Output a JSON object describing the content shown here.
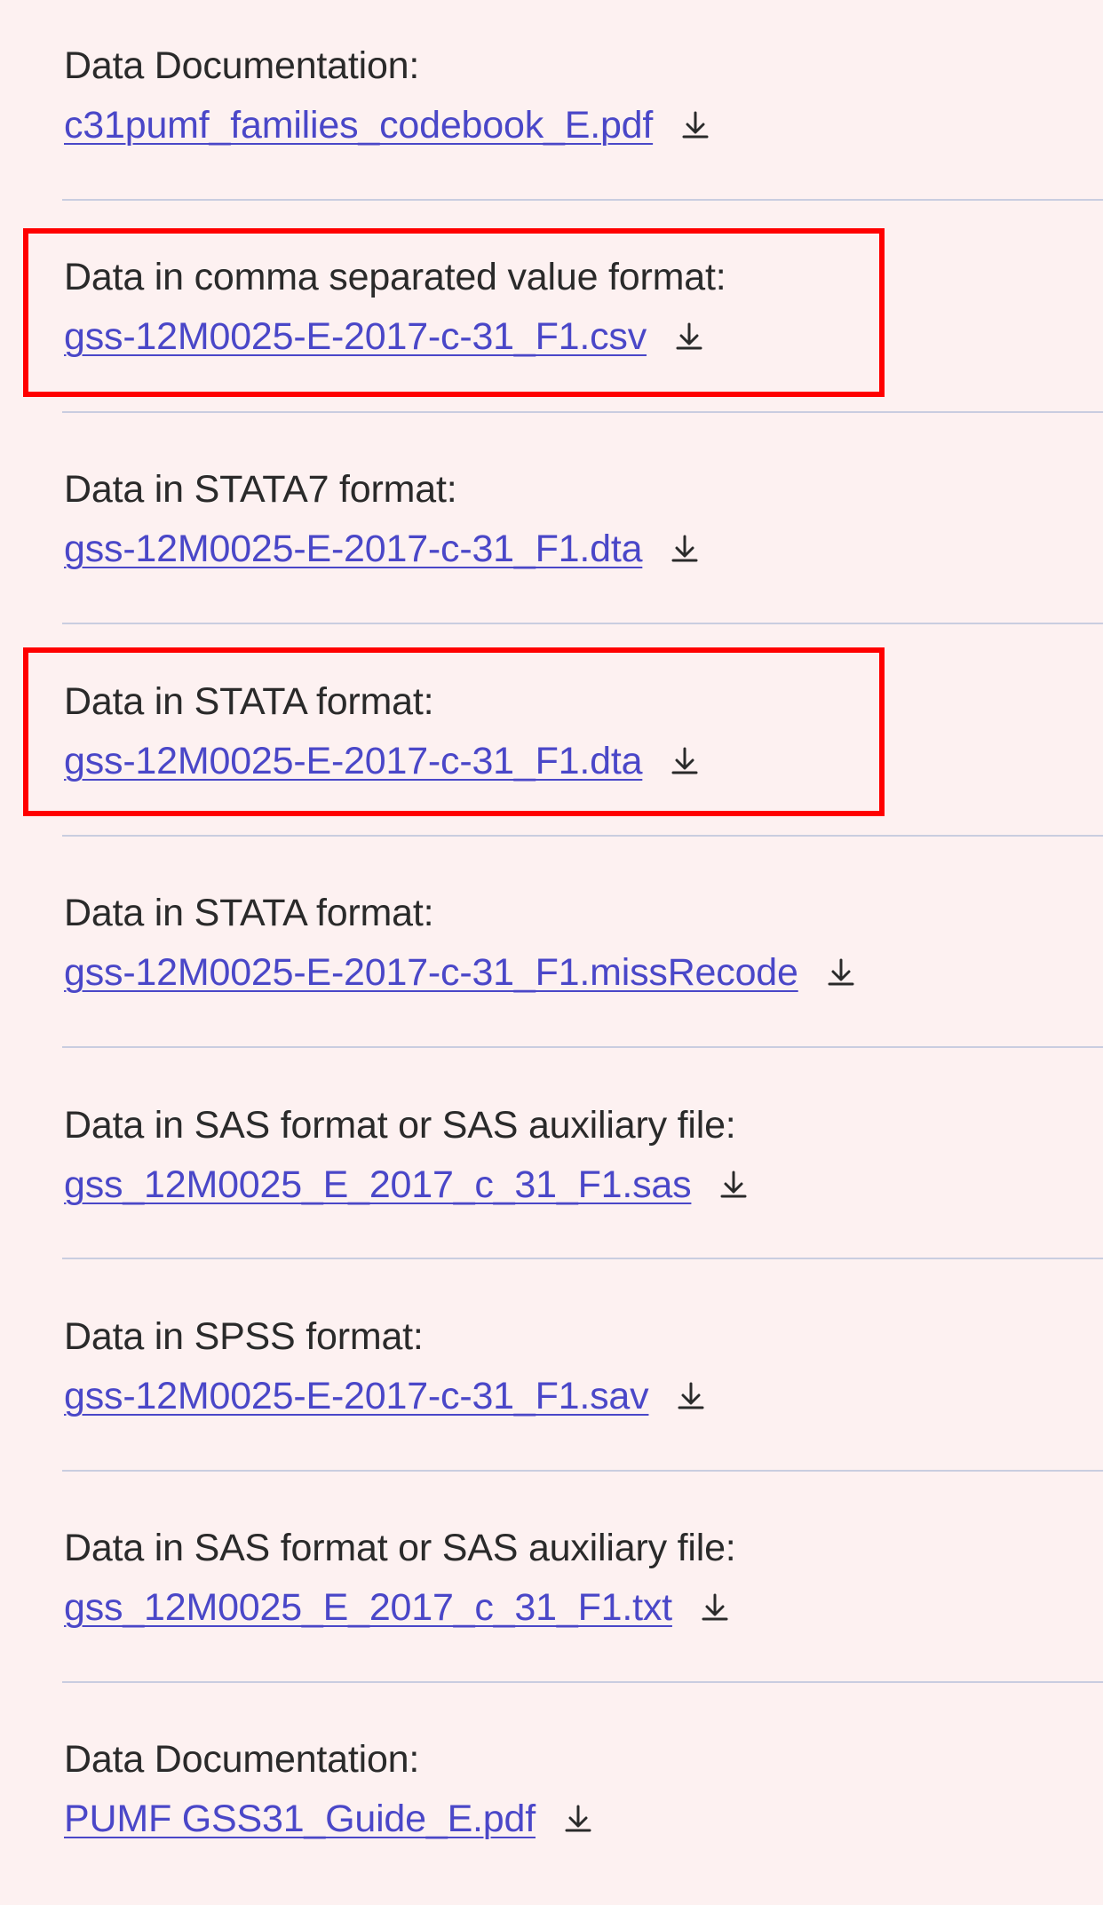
{
  "entries": [
    {
      "label": "Data Documentation:",
      "link": "c31pumf_families_codebook_E.pdf",
      "icon": "download-icon"
    },
    {
      "label": "Data in comma separated value format:",
      "link": "gss-12M0025-E-2017-c-31_F1.csv",
      "icon": "download-icon"
    },
    {
      "label": "Data in STATA7 format:",
      "link": "gss-12M0025-E-2017-c-31_F1.dta",
      "icon": "download-icon"
    },
    {
      "label": "Data in STATA format:",
      "link": "gss-12M0025-E-2017-c-31_F1.dta",
      "icon": "download-icon"
    },
    {
      "label": "Data in STATA format:",
      "link": "gss-12M0025-E-2017-c-31_F1.missRecode",
      "icon": "download-icon"
    },
    {
      "label": "Data in SAS format or SAS auxiliary file:",
      "link": "gss_12M0025_E_2017_c_31_F1.sas",
      "icon": "download-icon"
    },
    {
      "label": "Data in SPSS format:",
      "link": "gss-12M0025-E-2017-c-31_F1.sav",
      "icon": "download-icon"
    },
    {
      "label": "Data in SAS format or SAS auxiliary file:",
      "link": "gss_12M0025_E_2017_c_31_F1.txt",
      "icon": "download-icon"
    },
    {
      "label": "Data Documentation:",
      "link": "PUMF GSS31_Guide_E.pdf",
      "icon": "download-icon"
    }
  ],
  "highlighted_entries": [
    1,
    3
  ],
  "colors": {
    "background": "#fdf1f1",
    "link": "#4a47c8",
    "label": "#2a2a2a",
    "separator": "#c9cde0",
    "highlight": "#ff0000"
  }
}
